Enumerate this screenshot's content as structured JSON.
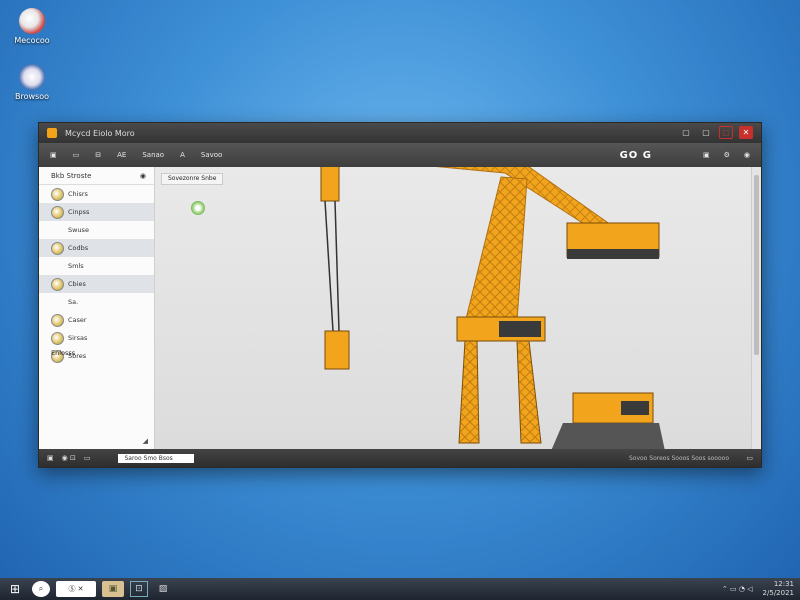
{
  "desktop": {
    "icons": [
      {
        "label": "Mecocoo",
        "icon": "app-globe-icon"
      },
      {
        "label": "Browsoo",
        "icon": "browser-icon"
      }
    ]
  },
  "window": {
    "title": "Mcycd Eiolo Moro",
    "controls": {
      "minimize": "▢",
      "restore": "▢",
      "max": "▢",
      "close": "✕"
    },
    "toolbar": {
      "items": [
        "▣",
        "▭",
        "⊟",
        "AE",
        "Sanao",
        "A",
        "Savoo"
      ],
      "brand": "GO G",
      "right": [
        "▣",
        "⚙",
        "◉"
      ]
    },
    "sidebar": {
      "header": "Bkb Stroste",
      "header_icon": "◉",
      "items": [
        {
          "label": "Chisrs",
          "selected": false
        },
        {
          "label": "Cinpss",
          "selected": true
        },
        {
          "label": "Swuse",
          "selected": false,
          "plain": true
        },
        {
          "label": "Codbs",
          "selected": true
        },
        {
          "label": "Smls",
          "selected": false,
          "plain": true
        },
        {
          "label": "Cbies",
          "selected": true
        },
        {
          "label": "Sa.",
          "selected": false,
          "plain": true
        },
        {
          "label": "Caser",
          "selected": false
        },
        {
          "label": "Sirsas",
          "selected": false
        },
        {
          "label": "Sbres",
          "selected": false
        }
      ],
      "footer": "Enlosss",
      "corner": "◢"
    },
    "canvas": {
      "tab": "Sovezonre Snbe"
    },
    "statusbar": {
      "buttons": [
        "▣",
        "◉ ⊡",
        "▭"
      ],
      "field": "Saroo  Smo  Bsos",
      "text": "Sovoo Soreos Sooos Soos sooooo",
      "end": "▭"
    }
  },
  "taskbar": {
    "start": "⊞",
    "pill": "Ⓢ ✕",
    "apps": [
      "▣",
      "⊡",
      "▨"
    ],
    "tray": "⌃ ▭ ◔ ◁",
    "time": "12:31",
    "date": "2/5/2021"
  },
  "colors": {
    "crane": "#f2a51c",
    "crane_dark": "#c57a10",
    "desktop": "#3d8fd6",
    "titlebar": "#3a3a3a"
  }
}
